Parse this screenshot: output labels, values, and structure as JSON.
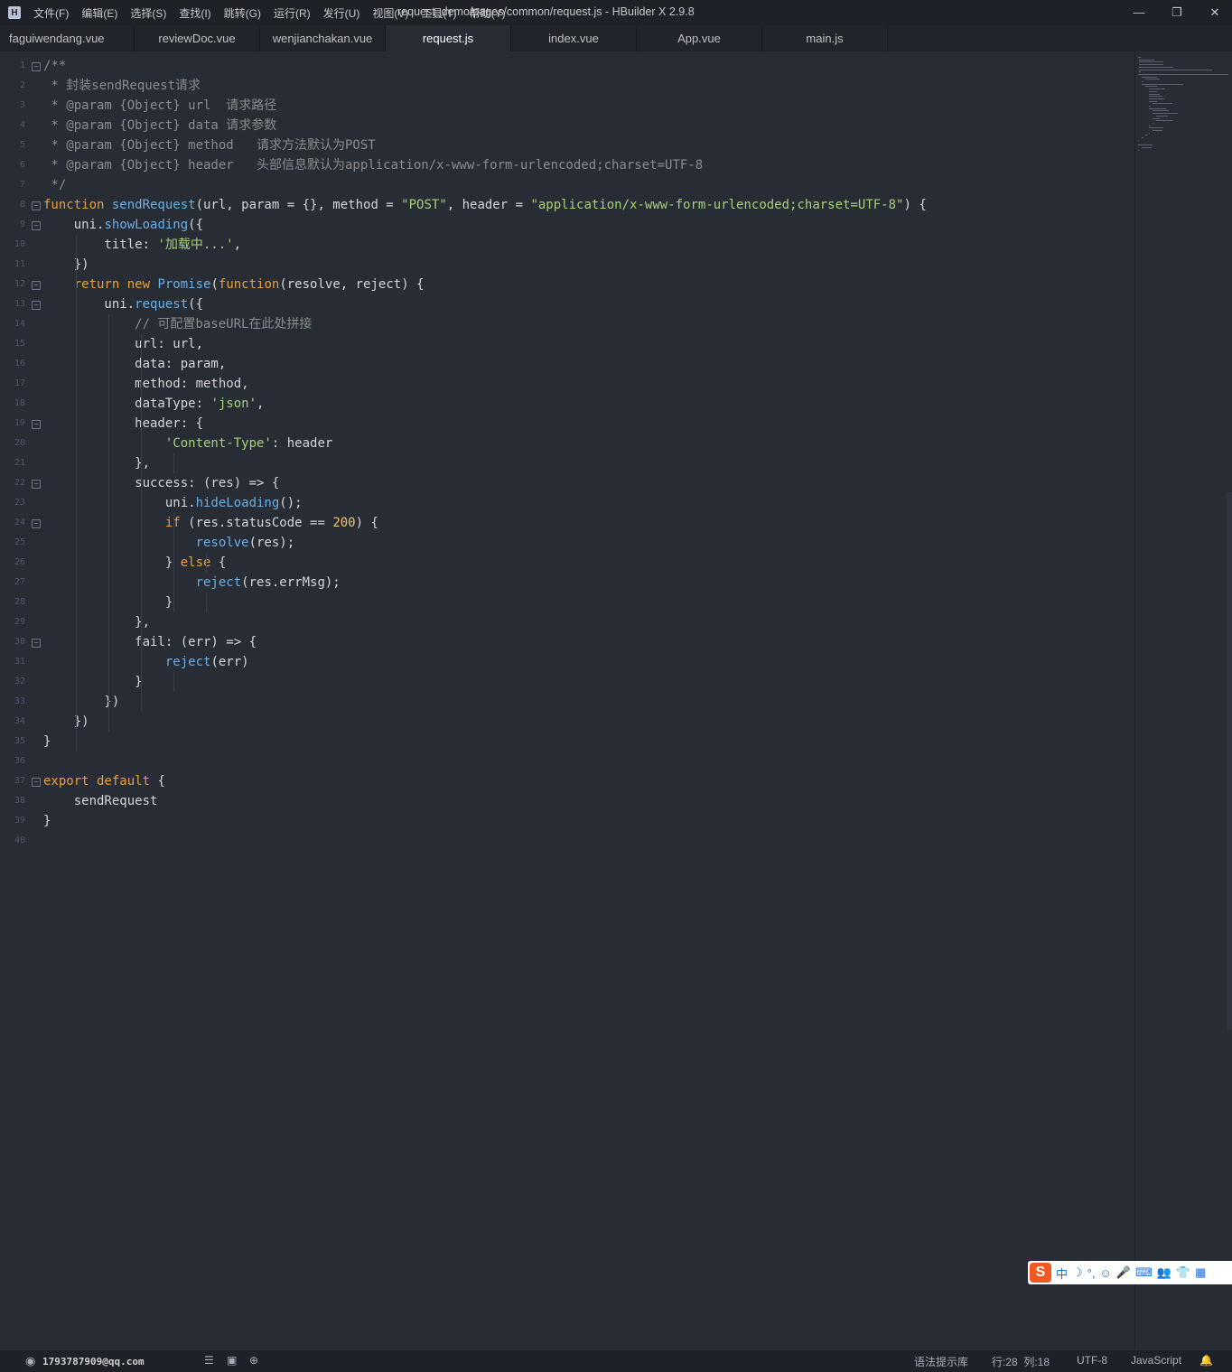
{
  "app": {
    "icon_label": "H",
    "window_title": "request_demo/pages/common/request.js - HBuilder X 2.9.8"
  },
  "menu": [
    "文件(F)",
    "编辑(E)",
    "选择(S)",
    "查找(I)",
    "跳转(G)",
    "运行(R)",
    "发行(U)",
    "视图(V)",
    "工具(T)",
    "帮助(Y)"
  ],
  "window_controls": {
    "minimize": "—",
    "restore": "❐",
    "close": "✕"
  },
  "tabs": [
    {
      "label": "faguiwendang.vue",
      "active": false
    },
    {
      "label": "reviewDoc.vue",
      "active": false
    },
    {
      "label": "wenjianchakan.vue",
      "active": false
    },
    {
      "label": "request.js",
      "active": true
    },
    {
      "label": "index.vue",
      "active": false
    },
    {
      "label": "App.vue",
      "active": false
    },
    {
      "label": "main.js",
      "active": false
    }
  ],
  "code": [
    {
      "n": "1",
      "fold": true,
      "tokens": [
        [
          "c-cmt",
          "/**"
        ]
      ]
    },
    {
      "n": "2",
      "tokens": [
        [
          "c-cmt",
          " * 封装sendRequest请求"
        ]
      ]
    },
    {
      "n": "3",
      "tokens": [
        [
          "c-cmt",
          " * @param {Object} url  请求路径"
        ]
      ]
    },
    {
      "n": "4",
      "tokens": [
        [
          "c-cmt",
          " * @param {Object} data 请求参数"
        ]
      ]
    },
    {
      "n": "5",
      "tokens": [
        [
          "c-cmt",
          " * @param {Object} method   请求方法默认为POST"
        ]
      ]
    },
    {
      "n": "6",
      "tokens": [
        [
          "c-cmt",
          " * @param {Object} header   头部信息默认为application/x-www-form-urlencoded;charset=UTF-8"
        ]
      ]
    },
    {
      "n": "7",
      "tokens": [
        [
          "c-cmt",
          " */"
        ]
      ]
    },
    {
      "n": "8",
      "fold": true,
      "tokens": [
        [
          "c-kw",
          "function "
        ],
        [
          "c-fn",
          "sendRequest"
        ],
        [
          "c-txt",
          "(url, param = {}, method = "
        ],
        [
          "c-str",
          "\"POST\""
        ],
        [
          "c-txt",
          ", header = "
        ],
        [
          "c-str",
          "\"application/x-www-form-urlencoded;charset=UTF-8\""
        ],
        [
          "c-txt",
          ") {"
        ]
      ]
    },
    {
      "n": "9",
      "fold": true,
      "tokens": [
        [
          "c-txt",
          "    uni."
        ],
        [
          "c-fn",
          "showLoading"
        ],
        [
          "c-txt",
          "({"
        ]
      ]
    },
    {
      "n": "10",
      "tokens": [
        [
          "c-txt",
          "        title: "
        ],
        [
          "c-str",
          "'加载中...'"
        ],
        [
          "c-txt",
          ","
        ]
      ]
    },
    {
      "n": "11",
      "tokens": [
        [
          "c-txt",
          "    })"
        ]
      ]
    },
    {
      "n": "12",
      "fold": true,
      "tokens": [
        [
          "c-kw",
          "    return new "
        ],
        [
          "c-fn",
          "Promise"
        ],
        [
          "c-txt",
          "("
        ],
        [
          "c-kw",
          "function"
        ],
        [
          "c-txt",
          "(resolve, reject) {"
        ]
      ]
    },
    {
      "n": "13",
      "fold": true,
      "tokens": [
        [
          "c-txt",
          "        uni."
        ],
        [
          "c-fn",
          "request"
        ],
        [
          "c-txt",
          "({"
        ]
      ]
    },
    {
      "n": "14",
      "tokens": [
        [
          "c-cmt",
          "            // 可配置baseURL在此处拼接"
        ]
      ]
    },
    {
      "n": "15",
      "tokens": [
        [
          "c-txt",
          "            url: url,"
        ]
      ]
    },
    {
      "n": "16",
      "tokens": [
        [
          "c-txt",
          "            data: param,"
        ]
      ]
    },
    {
      "n": "17",
      "tokens": [
        [
          "c-txt",
          "            method: method,"
        ]
      ]
    },
    {
      "n": "18",
      "tokens": [
        [
          "c-txt",
          "            dataType: "
        ],
        [
          "c-str",
          "'json'"
        ],
        [
          "c-txt",
          ","
        ]
      ]
    },
    {
      "n": "19",
      "fold": true,
      "tokens": [
        [
          "c-txt",
          "            header: {"
        ]
      ]
    },
    {
      "n": "20",
      "tokens": [
        [
          "c-str",
          "                'Content-Type'"
        ],
        [
          "c-txt",
          ": header"
        ]
      ]
    },
    {
      "n": "21",
      "tokens": [
        [
          "c-txt",
          "            },"
        ]
      ]
    },
    {
      "n": "22",
      "fold": true,
      "tokens": [
        [
          "c-txt",
          "            success: (res) => {"
        ]
      ]
    },
    {
      "n": "23",
      "tokens": [
        [
          "c-txt",
          "                uni."
        ],
        [
          "c-fn",
          "hideLoading"
        ],
        [
          "c-txt",
          "();"
        ]
      ]
    },
    {
      "n": "24",
      "fold": true,
      "tokens": [
        [
          "c-kw",
          "                if "
        ],
        [
          "c-txt",
          "(res.statusCode == "
        ],
        [
          "c-num",
          "200"
        ],
        [
          "c-txt",
          ") {"
        ]
      ]
    },
    {
      "n": "25",
      "tokens": [
        [
          "c-fn",
          "                    resolve"
        ],
        [
          "c-txt",
          "(res);"
        ]
      ]
    },
    {
      "n": "26",
      "tokens": [
        [
          "c-txt",
          "                } "
        ],
        [
          "c-kw",
          "else"
        ],
        [
          "c-txt",
          " {"
        ]
      ]
    },
    {
      "n": "27",
      "tokens": [
        [
          "c-fn",
          "                    reject"
        ],
        [
          "c-txt",
          "(res.errMsg);"
        ]
      ]
    },
    {
      "n": "28",
      "tokens": [
        [
          "c-txt",
          "                }"
        ]
      ]
    },
    {
      "n": "29",
      "tokens": [
        [
          "c-txt",
          "            },"
        ]
      ]
    },
    {
      "n": "30",
      "fold": true,
      "tokens": [
        [
          "c-txt",
          "            fail: (err) => {"
        ]
      ]
    },
    {
      "n": "31",
      "tokens": [
        [
          "c-fn",
          "                reject"
        ],
        [
          "c-txt",
          "(err)"
        ]
      ]
    },
    {
      "n": "32",
      "tokens": [
        [
          "c-txt",
          "            }"
        ]
      ]
    },
    {
      "n": "33",
      "tokens": [
        [
          "c-txt",
          "        })"
        ]
      ]
    },
    {
      "n": "34",
      "tokens": [
        [
          "c-txt",
          "    })"
        ]
      ]
    },
    {
      "n": "35",
      "tokens": [
        [
          "c-txt",
          "}"
        ]
      ]
    },
    {
      "n": "36",
      "tokens": []
    },
    {
      "n": "37",
      "fold": true,
      "tokens": [
        [
          "c-kw",
          "export default"
        ],
        [
          "c-txt",
          " {"
        ]
      ]
    },
    {
      "n": "38",
      "tokens": [
        [
          "c-txt",
          "    sendRequest"
        ]
      ]
    },
    {
      "n": "39",
      "tokens": [
        [
          "c-txt",
          "}"
        ]
      ]
    },
    {
      "n": "40",
      "tokens": []
    }
  ],
  "ime": {
    "logo": "S",
    "icons": [
      "中",
      "☽",
      "°,",
      "☺",
      "🎤",
      "⌨",
      "👥",
      "👕",
      "▦"
    ]
  },
  "status": {
    "user": "1793787909@qq.com",
    "user_icon": "user-icon",
    "grammar": "语法提示库",
    "position": "行:28  列:18",
    "encoding": "UTF-8",
    "language": "JavaScript",
    "colors": {
      "keyword": "#e8a03a",
      "function": "#67b0e8",
      "string": "#a6d17a",
      "number": "#f0c674",
      "comment": "#8c8c8c"
    }
  }
}
